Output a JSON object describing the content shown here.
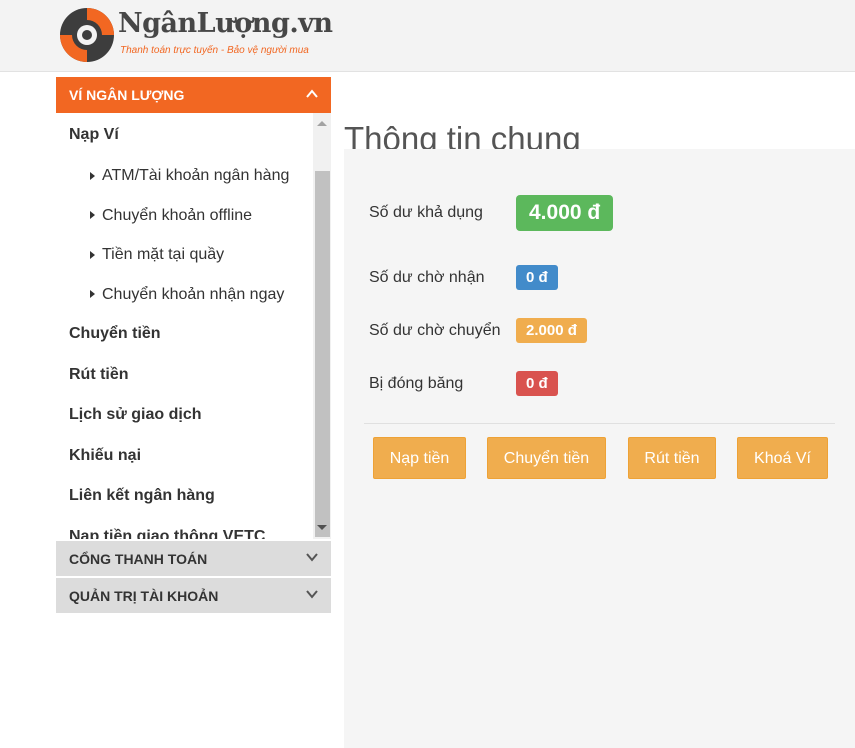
{
  "brand": {
    "name": "NgânLượng.vn",
    "tagline": "Thanh toán trực tuyến - Bảo vệ người mua",
    "colors": {
      "orange": "#f26722",
      "dark": "#3d3d3d"
    }
  },
  "sidebar": {
    "wallet_panel": {
      "title": "VÍ NGÂN LƯỢNG",
      "toggle_icon": "chevron-up-icon",
      "items": [
        {
          "label": "Nạp Ví"
        },
        {
          "label": "ATM/Tài khoản ngân hàng"
        },
        {
          "label": "Chuyển khoản offline"
        },
        {
          "label": "Tiền mặt tại quầy"
        },
        {
          "label": "Chuyển khoản nhận ngay"
        },
        {
          "label": "Chuyển tiền"
        },
        {
          "label": "Rút tiền"
        },
        {
          "label": "Lịch sử giao dịch"
        },
        {
          "label": "Khiếu nại"
        },
        {
          "label": "Liên kết ngân hàng"
        },
        {
          "label": "Nạp tiền giao thông VETC"
        }
      ]
    },
    "collapsed_panels": [
      {
        "title": "CỔNG THANH TOÁN",
        "toggle_icon": "chevron-down-icon"
      },
      {
        "title": "QUẢN TRỊ TÀI KHOẢN",
        "toggle_icon": "chevron-down-icon"
      }
    ]
  },
  "main": {
    "title": "Thông tin chung",
    "balances": [
      {
        "label": "Số dư khả dụng",
        "value": "4.000 đ",
        "color": "#5cb85c"
      },
      {
        "label": "Số dư chờ nhận",
        "value": "0 đ",
        "color": "#428bca"
      },
      {
        "label": "Số dư chờ chuyển",
        "value": "2.000 đ",
        "color": "#f0ad4e"
      },
      {
        "label": "Bị đóng băng",
        "value": "0 đ",
        "color": "#d9534f"
      }
    ],
    "buttons": [
      {
        "label": "Nạp tiền"
      },
      {
        "label": "Chuyển tiền"
      },
      {
        "label": "Rút tiền"
      },
      {
        "label": "Khoá Ví"
      }
    ]
  }
}
